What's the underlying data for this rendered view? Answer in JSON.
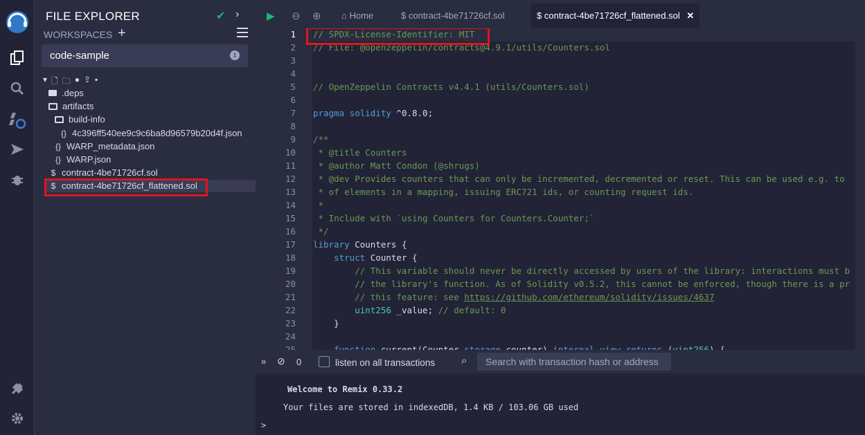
{
  "panel": {
    "title": "FILE EXPLORER",
    "workspaces_label": "WORKSPACES",
    "workspace_selected": "code-sample"
  },
  "tree": [
    {
      "label": ".deps",
      "type": "folder"
    },
    {
      "label": "artifacts",
      "type": "folder-open"
    },
    {
      "label": "build-info",
      "type": "folder-open"
    },
    {
      "label": "4c396ff540ee9c9c6ba8d96579b20d4f.json",
      "type": "json"
    },
    {
      "label": "WARP_metadata.json",
      "type": "json"
    },
    {
      "label": "WARP.json",
      "type": "json"
    },
    {
      "label": "contract-4be71726cf.sol",
      "type": "sol"
    },
    {
      "label": "contract-4be71726cf_flattened.sol",
      "type": "sol",
      "selected": true
    }
  ],
  "tabs": {
    "home": "Home",
    "tab1": "contract-4be71726cf.sol",
    "tab2": "contract-4be71726cf_flattened.sol"
  },
  "editor": {
    "line_numbers": [
      "1",
      "2",
      "3",
      "4",
      "5",
      "6",
      "7",
      "8",
      "9",
      "10",
      "11",
      "12",
      "13",
      "14",
      "15",
      "16",
      "17",
      "18",
      "19",
      "20",
      "21",
      "22",
      "23",
      "24",
      "25"
    ],
    "lines": [
      "// SPDX-License-Identifier: MIT",
      "// File: @openzeppelin/contracts@4.9.1/utils/Counters.sol",
      "",
      "",
      "// OpenZeppelin Contracts v4.4.1 (utils/Counters.sol)",
      "",
      "pragma solidity ^0.8.0;",
      "",
      "/**",
      " * @title Counters",
      " * @author Matt Condon (@shrugs)",
      " * @dev Provides counters that can only be incremented, decremented or reset. This can be used e.g. to",
      " * of elements in a mapping, issuing ERC721 ids, or counting request ids.",
      " *",
      " * Include with `using Counters for Counters.Counter;`",
      " */",
      "library Counters {",
      "    struct Counter {",
      "        // This variable should never be directly accessed by users of the library: interactions must b",
      "        // the library's function. As of Solidity v0.5.2, this cannot be enforced, though there is a pr",
      "        // this feature: see https://github.com/ethereum/solidity/issues/4637",
      "        uint256 _value; // default: 0",
      "    }",
      "",
      "    function current(Counter storage counter) internal view returns (uint256) {"
    ]
  },
  "terminal": {
    "count": "0",
    "listen_label": "listen on all transactions",
    "search_placeholder": "Search with transaction hash or address",
    "welcome": "Welcome to Remix 0.33.2",
    "storage": "Your files are stored in indexedDB, 1.4 KB / 103.06 GB used",
    "prompt": ">"
  },
  "colors": {
    "highlight": "#e3141f",
    "accent_green": "#1ab877"
  },
  "icons": [
    "remix-logo-icon",
    "file-manager-icon",
    "search-icon",
    "compile-icon",
    "deploy-icon",
    "debug-icon",
    "plugin-icon",
    "settings-icon"
  ]
}
